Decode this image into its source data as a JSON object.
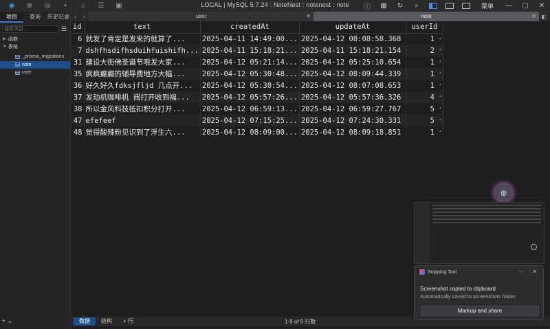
{
  "titlebar": {
    "title": "LOCAL | MySQL 5.7.24 : NoteNest : notenest : note",
    "menu_label": "菜单"
  },
  "sidebar": {
    "tabs": [
      "项目",
      "查询",
      "历史记录"
    ],
    "search_placeholder": "搜索项目...",
    "groups": [
      {
        "label": "函数",
        "expanded": false
      },
      {
        "label": "表格",
        "expanded": true
      }
    ],
    "tables": [
      {
        "label": "_prisma_migrations",
        "selected": false
      },
      {
        "label": "note",
        "selected": true
      },
      {
        "label": "user",
        "selected": false
      }
    ],
    "bottom_label": "+ ⌄"
  },
  "tabs": [
    {
      "label": "user",
      "active": false
    },
    {
      "label": "note",
      "active": true
    }
  ],
  "grid": {
    "columns": [
      "id",
      "text",
      "createdAt",
      "updateAt",
      "userId"
    ],
    "rows": [
      {
        "id": "6",
        "text": "就发了肯定是发来的就算了...",
        "createdAt": "2025-04-11 14:49:00...",
        "updateAt": "2025-04-12 08:08:58.368",
        "userId": "1"
      },
      {
        "id": "7",
        "text": "dshfhsdifhsduihfuishifh...",
        "createdAt": "2025-04-11 15:18:21...",
        "updateAt": "2025-04-11 15:18:21.154",
        "userId": "2"
      },
      {
        "id": "31",
        "text": "建设大街佛圣诞节哦发大家...",
        "createdAt": "2025-04-12 05:21:14...",
        "updateAt": "2025-04-12 05:25:10.654",
        "userId": "1"
      },
      {
        "id": "35",
        "text": "疯疯癫癫的辅导费地方大幅...",
        "createdAt": "2025-04-12 05:30:48...",
        "updateAt": "2025-04-12 08:09:44.339",
        "userId": "1"
      },
      {
        "id": "36",
        "text": "好久好久fdksjfljd 几点开...",
        "createdAt": "2025-04-12 05:30:54...",
        "updateAt": "2025-04-12 08:07:08.653",
        "userId": "1"
      },
      {
        "id": "37",
        "text": "发动机咖啡机 阀打开收到福...",
        "createdAt": "2025-04-12 05:57:26...",
        "updateAt": "2025-04-12 05:57:36.326",
        "userId": "4"
      },
      {
        "id": "38",
        "text": "所以金风科技抵扣积分打开...",
        "createdAt": "2025-04-12 06:59:13...",
        "updateAt": "2025-04-12 06:59:27.767",
        "userId": "5"
      },
      {
        "id": "47",
        "text": "efefeef",
        "createdAt": "2025-04-12 07:15:25...",
        "updateAt": "2025-04-12 07:24:30.331",
        "userId": "5"
      },
      {
        "id": "48",
        "text": "觉得酸辣粉见识到了浮生六...",
        "createdAt": "2025-04-12 08:09:00...",
        "updateAt": "2025-04-12 08:09:18.851",
        "userId": "1"
      }
    ]
  },
  "bottombar": {
    "data_tab": "数据",
    "structure_tab": "结构",
    "add_row": "+ 行",
    "status": "1-9 of 9 行数"
  },
  "toast": {
    "app": "Snipping Tool",
    "title": "Screenshot copied to clipboard",
    "subtitle": "Automatically saved to screenshots folder.",
    "button": "Markup and share"
  },
  "colors": {
    "accent": "#3a7bd5",
    "selected_row": "#1f4f8a",
    "background": "#1e1e20"
  }
}
